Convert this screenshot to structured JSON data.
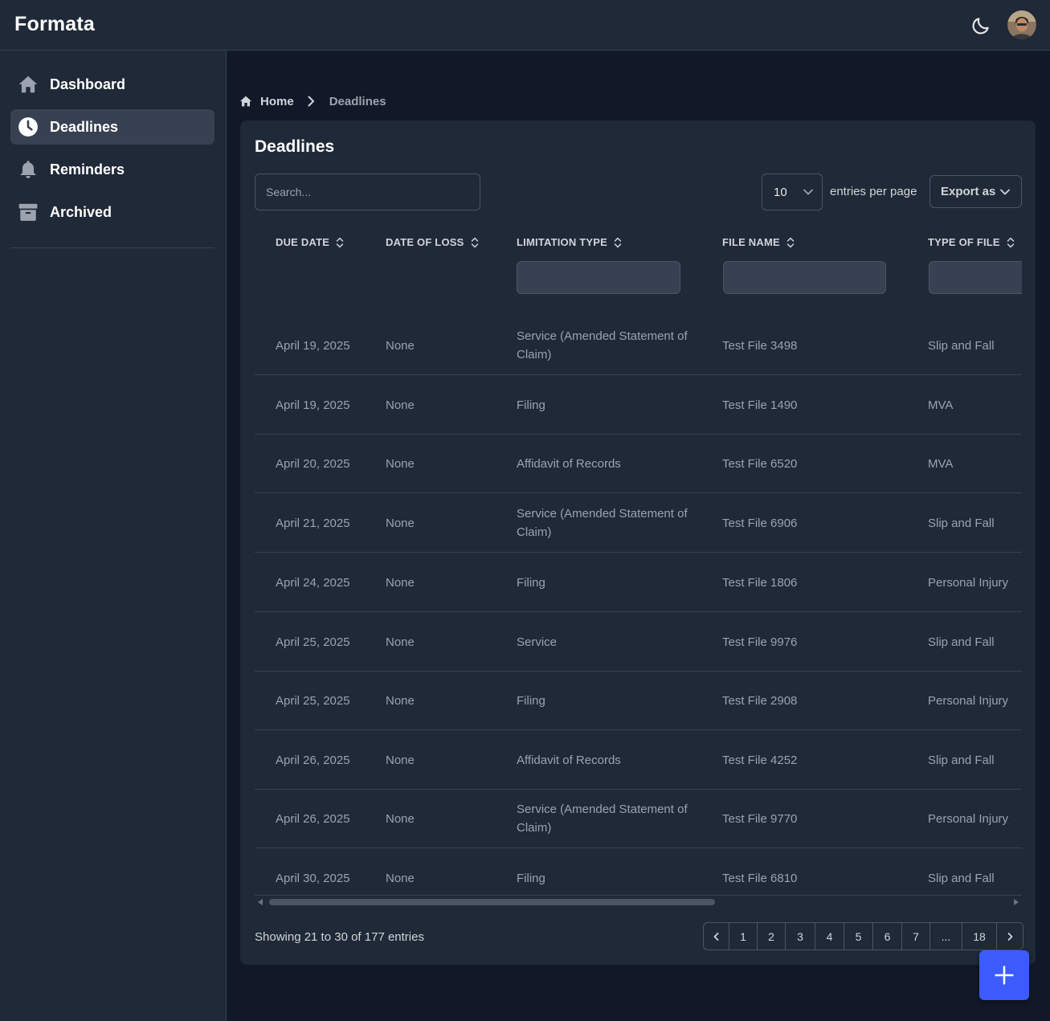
{
  "app": {
    "brand": "Formata"
  },
  "header": {
    "theme_icon": "moon-icon",
    "avatar": "user-avatar"
  },
  "sidebar": {
    "items": [
      {
        "label": "Dashboard",
        "icon": "home-icon",
        "active": false
      },
      {
        "label": "Deadlines",
        "icon": "clock-icon",
        "active": true
      },
      {
        "label": "Reminders",
        "icon": "bell-icon",
        "active": false
      },
      {
        "label": "Archived",
        "icon": "archive-icon",
        "active": false
      }
    ]
  },
  "breadcrumb": {
    "home": "Home",
    "current": "Deadlines"
  },
  "card": {
    "title": "Deadlines",
    "search_placeholder": "Search...",
    "per_page_value": "10",
    "per_page_label": "entries per page",
    "export_label": "Export as"
  },
  "table": {
    "columns": [
      "DUE DATE",
      "DATE OF LOSS",
      "LIMITATION TYPE",
      "FILE NAME",
      "TYPE OF FILE"
    ],
    "rows": [
      {
        "due_date": "April 19, 2025",
        "date_of_loss": "None",
        "limitation_type": "Service (Amended Statement of Claim)",
        "file_name": "Test File 3498",
        "type_of_file": "Slip and Fall"
      },
      {
        "due_date": "April 19, 2025",
        "date_of_loss": "None",
        "limitation_type": "Filing",
        "file_name": "Test File 1490",
        "type_of_file": "MVA"
      },
      {
        "due_date": "April 20, 2025",
        "date_of_loss": "None",
        "limitation_type": "Affidavit of Records",
        "file_name": "Test File 6520",
        "type_of_file": "MVA"
      },
      {
        "due_date": "April 21, 2025",
        "date_of_loss": "None",
        "limitation_type": "Service (Amended Statement of Claim)",
        "file_name": "Test File 6906",
        "type_of_file": "Slip and Fall"
      },
      {
        "due_date": "April 24, 2025",
        "date_of_loss": "None",
        "limitation_type": "Filing",
        "file_name": "Test File 1806",
        "type_of_file": "Personal Injury"
      },
      {
        "due_date": "April 25, 2025",
        "date_of_loss": "None",
        "limitation_type": "Service",
        "file_name": "Test File 9976",
        "type_of_file": "Slip and Fall"
      },
      {
        "due_date": "April 25, 2025",
        "date_of_loss": "None",
        "limitation_type": "Filing",
        "file_name": "Test File 2908",
        "type_of_file": "Personal Injury"
      },
      {
        "due_date": "April 26, 2025",
        "date_of_loss": "None",
        "limitation_type": "Affidavit of Records",
        "file_name": "Test File 4252",
        "type_of_file": "Slip and Fall"
      },
      {
        "due_date": "April 26, 2025",
        "date_of_loss": "None",
        "limitation_type": "Service (Amended Statement of Claim)",
        "file_name": "Test File 9770",
        "type_of_file": "Personal Injury"
      },
      {
        "due_date": "April 30, 2025",
        "date_of_loss": "None",
        "limitation_type": "Filing",
        "file_name": "Test File 6810",
        "type_of_file": "Slip and Fall"
      }
    ]
  },
  "pagination": {
    "showing": "Showing 21 to 30 of 177 entries",
    "pages": [
      "1",
      "2",
      "3",
      "4",
      "5",
      "6",
      "7",
      "...",
      "18"
    ]
  },
  "fab": {
    "icon": "plus-icon"
  },
  "colors": {
    "accent": "#3b5bfc",
    "background": "#111827",
    "surface": "#1f2937"
  }
}
